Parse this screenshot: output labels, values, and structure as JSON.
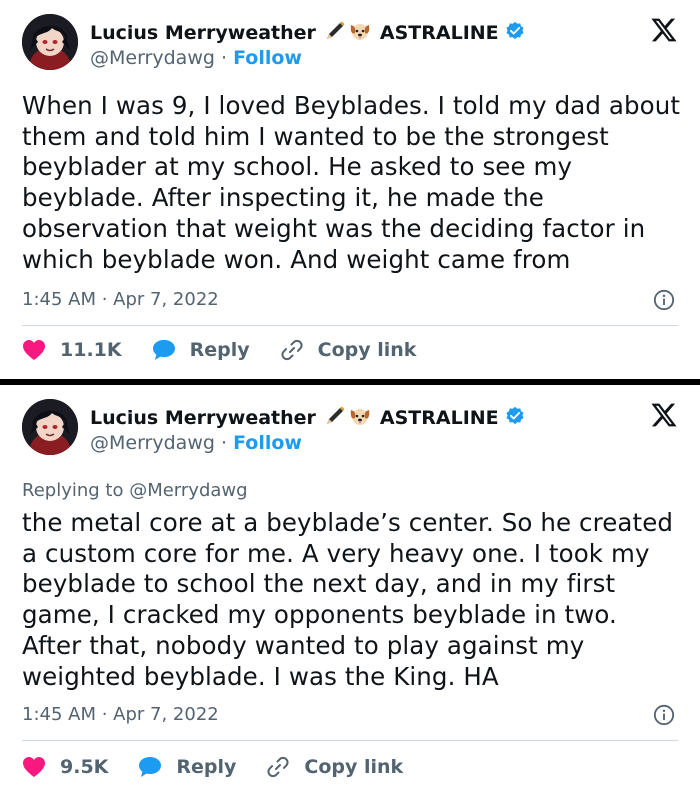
{
  "tweets": [
    {
      "author": {
        "display_name": "Lucius Merryweather",
        "brand": "ASTRALINE",
        "handle": "@Merrydawg",
        "separator": "·",
        "follow_label": "Follow",
        "emoji_icons": [
          "pen-icon",
          "dog-face-icon"
        ]
      },
      "reply_to": "",
      "text": "When I was 9, I loved Beyblades. I told my dad about them and told him I wanted to be the strongest beyblader at my school. He asked to see my beyblade. After inspecting it, he made the observation that weight was the deciding factor in which beyblade won. And weight came from",
      "timestamp": "1:45 AM · Apr 7, 2022",
      "likes": "11.1K",
      "reply_label": "Reply",
      "copy_link_label": "Copy link"
    },
    {
      "author": {
        "display_name": "Lucius Merryweather",
        "brand": "ASTRALINE",
        "handle": "@Merrydawg",
        "separator": "·",
        "follow_label": "Follow",
        "emoji_icons": [
          "pen-icon",
          "dog-face-icon"
        ]
      },
      "reply_to": "Replying to @Merrydawg",
      "text": "the metal core at a beyblade’s center. So he created a custom core for me. A very heavy one. I took my beyblade to school the next day, and in my first game, I cracked my opponents beyblade in two. After that, nobody wanted to play against my weighted beyblade. I was the King. HA",
      "timestamp": "1:45 AM · Apr 7, 2022",
      "likes": "9.5K",
      "reply_label": "Reply",
      "copy_link_label": "Copy link"
    }
  ],
  "colors": {
    "follow": "#1d9bf0",
    "heart": "#f91880",
    "reply_bubble": "#1d9bf0",
    "secondary_text": "#536471",
    "separator_bar": "#000000"
  }
}
